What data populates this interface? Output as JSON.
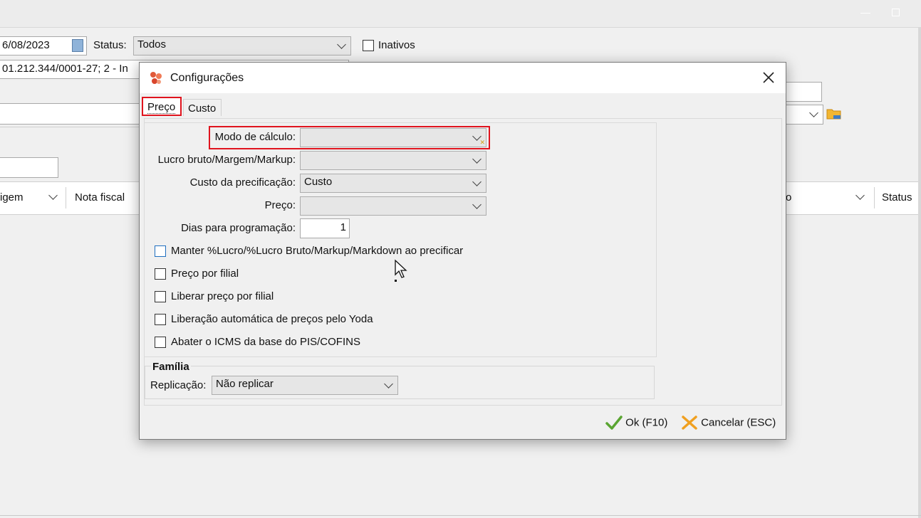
{
  "background": {
    "date_value": "6/08/2023",
    "status_label": "Status:",
    "status_value": "Todos",
    "inativos_label": "Inativos",
    "company_value": "01.212.344/0001-27; 2 - In",
    "grid_columns": [
      "igem",
      "Nota fiscal",
      "o",
      "Status"
    ]
  },
  "dialog": {
    "title": "Configurações",
    "tabs": [
      {
        "label": "Preço",
        "active": true
      },
      {
        "label": "Custo",
        "active": false
      }
    ],
    "fields": {
      "modo_calculo": {
        "label": "Modo de cálculo:",
        "value": ""
      },
      "lucro": {
        "label": "Lucro bruto/Margem/Markup:",
        "value": ""
      },
      "custo_precificacao": {
        "label": "Custo da precificação:",
        "value": "Custo"
      },
      "preco": {
        "label": "Preço:",
        "value": ""
      },
      "dias": {
        "label": "Dias para programação:",
        "value": "1"
      }
    },
    "checkboxes": [
      {
        "label": "Manter %Lucro/%Lucro Bruto/Markup/Markdown ao precificar",
        "checked": false
      },
      {
        "label": "Preço por filial",
        "checked": false
      },
      {
        "label": "Liberar preço por filial",
        "checked": false
      },
      {
        "label": "Liberação automática de preços pelo Yoda",
        "checked": false
      },
      {
        "label": "Abater o ICMS da base do PIS/COFINS",
        "checked": false
      }
    ],
    "familia": {
      "title": "Família",
      "replicacao_label": "Replicação:",
      "replicacao_value": "Não replicar"
    },
    "buttons": {
      "ok": "Ok (F10)",
      "cancel": "Cancelar (ESC)"
    }
  },
  "colors": {
    "highlight": "#e0141e",
    "ok_check": "#5aa532",
    "cancel_x": "#f0a020",
    "app_icon": "#e05a3a"
  }
}
